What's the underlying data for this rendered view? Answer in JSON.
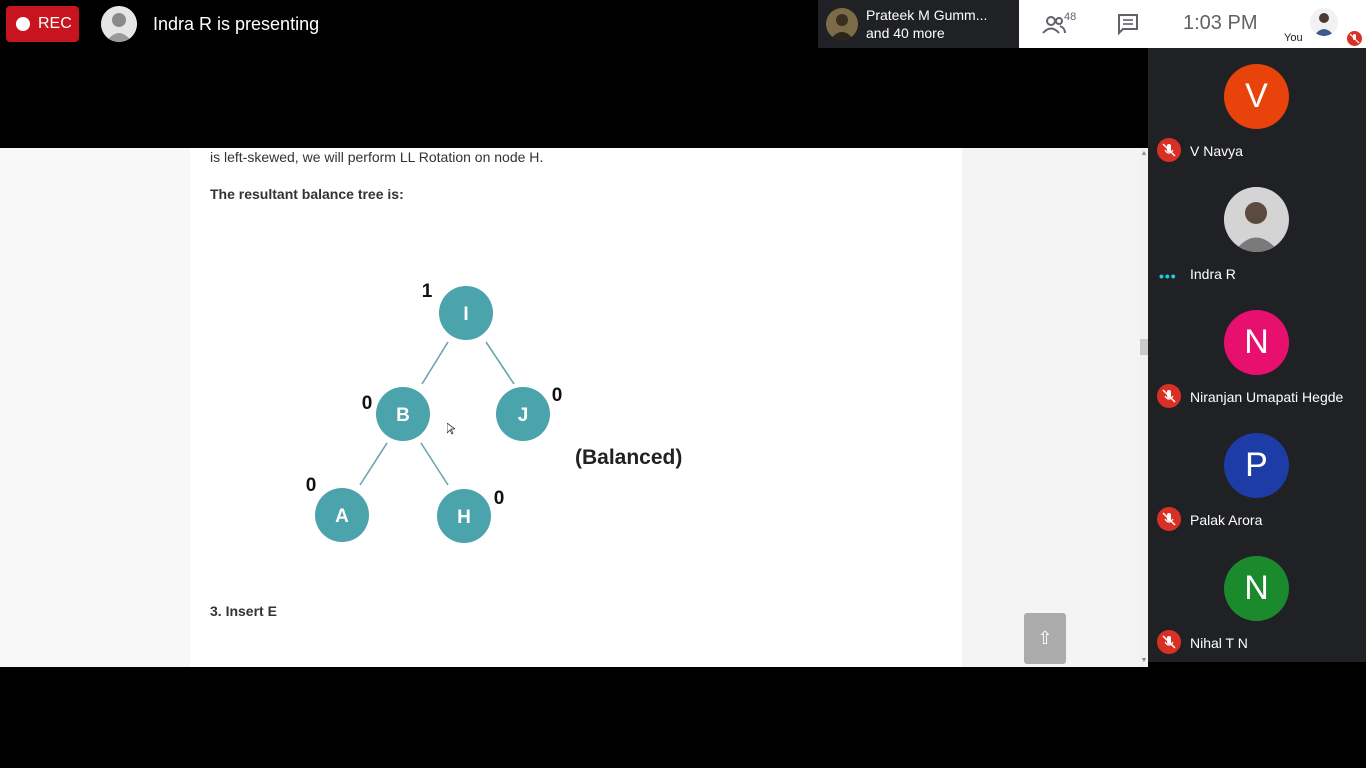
{
  "topbar": {
    "rec_label": "REC",
    "presenting_text": "Indra R is presenting",
    "participants_strip": {
      "line1": "Prateek M Gumm...",
      "line2": "and 40 more"
    },
    "people_count": "48",
    "time": "1:03 PM",
    "you_label": "You"
  },
  "document": {
    "paragraph_fragment": "is left-skewed, we will perform LL Rotation on node H.",
    "result_heading": "The resultant balance tree is:",
    "next_heading": "3. Insert E",
    "scroll_top_glyph": "⇧",
    "tree": {
      "node_color": "#4ba3ab",
      "nodes": [
        {
          "label": "I",
          "balance": "1"
        },
        {
          "label": "B",
          "balance": "0"
        },
        {
          "label": "J",
          "balance": "0"
        },
        {
          "label": "A",
          "balance": "0"
        },
        {
          "label": "H",
          "balance": "0"
        }
      ],
      "status_text": "(Balanced)"
    }
  },
  "participants": [
    {
      "initial": "V",
      "name": "V Navya",
      "color": "#e8430a",
      "status": "muted"
    },
    {
      "initial": "",
      "name": "Indra R",
      "color": "#cfcfcf",
      "status": "speaking"
    },
    {
      "initial": "N",
      "name": "Niranjan Umapati Hegde",
      "color": "#e8106f",
      "status": "muted"
    },
    {
      "initial": "P",
      "name": "Palak Arora",
      "color": "#1e3ca6",
      "status": "muted"
    },
    {
      "initial": "N",
      "name": "Nihal T N",
      "color": "#1b8a2d",
      "status": "muted"
    }
  ]
}
